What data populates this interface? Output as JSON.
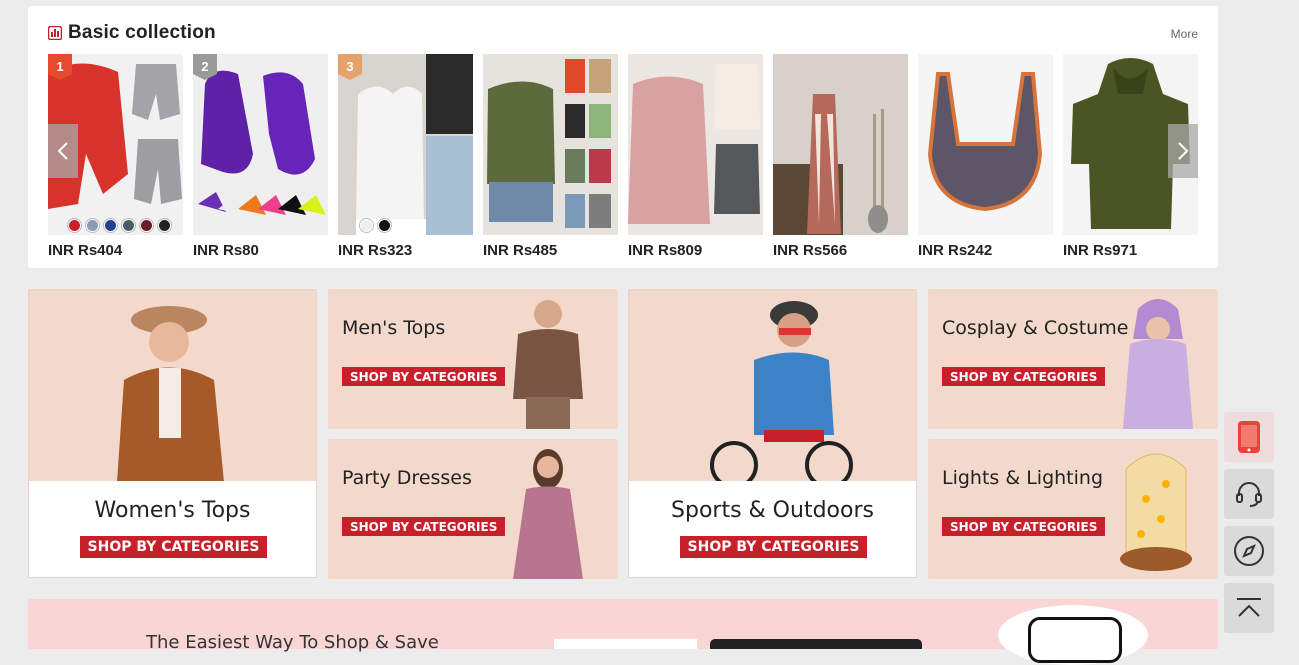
{
  "collection": {
    "title": "Basic collection",
    "more_label": "More",
    "products": [
      {
        "price": "INR Rs404",
        "rank": "1"
      },
      {
        "price": "INR Rs80",
        "rank": "2"
      },
      {
        "price": "INR Rs323",
        "rank": "3"
      },
      {
        "price": "INR Rs485"
      },
      {
        "price": "INR Rs809"
      },
      {
        "price": "INR Rs566"
      },
      {
        "price": "INR Rs242"
      },
      {
        "price": "INR Rs971"
      }
    ],
    "prev_icon": "chevron-left-icon",
    "next_icon": "chevron-right-icon"
  },
  "banners": [
    {
      "title": "Women's Tops",
      "button": "SHOP BY CATEGORIES"
    },
    {
      "title": "Men's Tops",
      "button": "SHOP BY CATEGORIES"
    },
    {
      "title": "Party Dresses",
      "button": "SHOP BY CATEGORIES"
    },
    {
      "title": "Sports & Outdoors",
      "button": "SHOP BY CATEGORIES"
    },
    {
      "title": "Cosplay & Costume",
      "button": "SHOP BY CATEGORIES"
    },
    {
      "title": "Lights & Lighting",
      "button": "SHOP BY CATEGORIES"
    }
  ],
  "promo": {
    "text": "The Easiest Way To Shop & Save"
  },
  "side_toolbar": [
    "phone-icon",
    "headset-icon",
    "compass-icon",
    "back-to-top-icon"
  ],
  "colors": {
    "accent": "#c8202a",
    "banner_bg": "#f3d9cc",
    "promo_bg": "#f9d5d5"
  }
}
